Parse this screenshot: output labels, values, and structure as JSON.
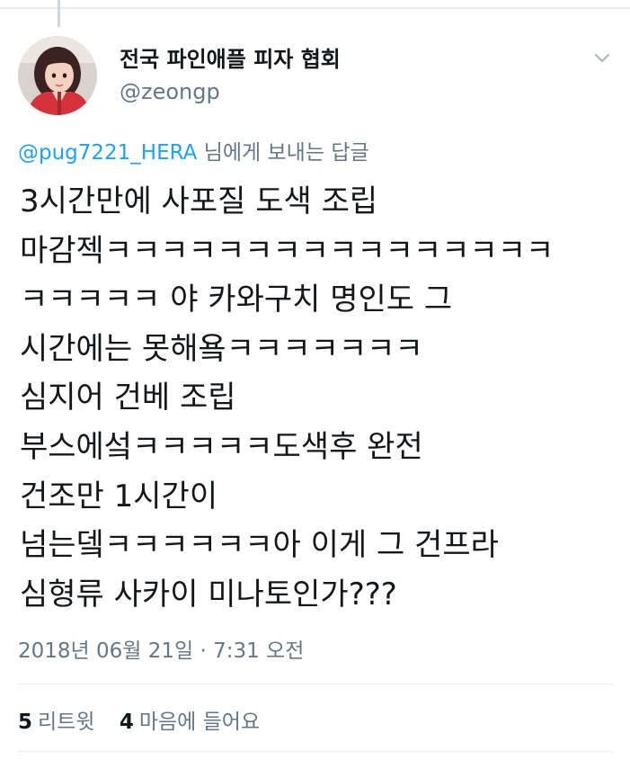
{
  "author": {
    "display_name": "전국 파인애플 피자 협회",
    "handle": "@zeongp"
  },
  "reply_context": {
    "mention": "@pug7221_HERA",
    "suffix": " 님에게 보내는 답글"
  },
  "tweet": {
    "lines": [
      "3시간만에 사포질 도색 조립",
      "마감젝ㅋㅋㅋㅋㅋㅋㅋㅋㅋㅋㅋㅋㅋㅋㅋㅋ",
      "ㅋㅋㅋㅋㅋ 야 카와구치 명인도 그",
      "시간에는 못해욬ㅋㅋㅋㅋㅋㅋㅋ",
      "심지어 건베 조립",
      "부스에섴ㅋㅋㅋㅋㅋ도색후 완전",
      "건조만 1시간이",
      "넘는뎈ㅋㅋㅋㅋㅋㅋ아 이게 그 건프라",
      "심형류 사카이 미나토인가???"
    ],
    "timestamp": "2018년 06월 21일 · 7:31 오전"
  },
  "stats": {
    "retweets_count": "5",
    "retweets_label": "리트윗",
    "likes_count": "4",
    "likes_label": "마음에 들어요"
  },
  "icons": {
    "caret": "chevron-down-icon"
  },
  "colors": {
    "link": "#1da1f2",
    "secondary_text": "#657786",
    "primary_text": "#14171a",
    "divider": "#e6ecf0"
  }
}
